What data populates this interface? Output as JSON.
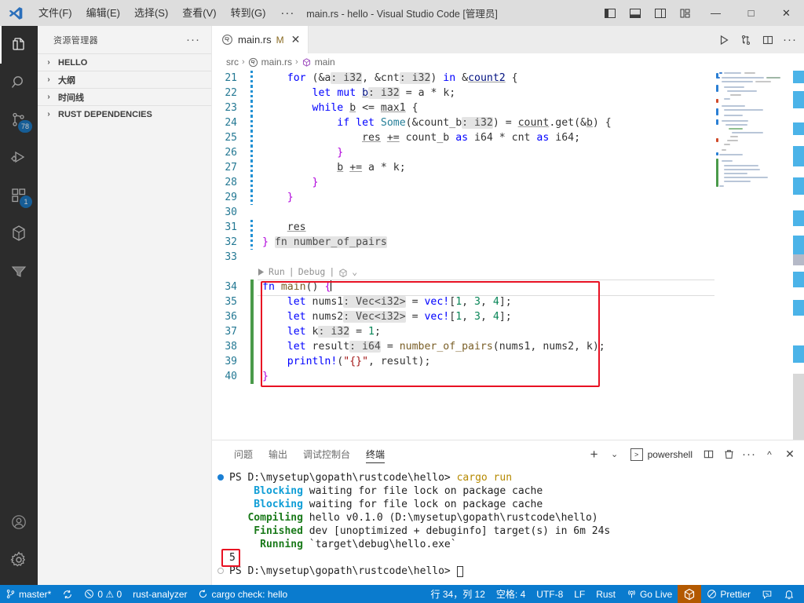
{
  "window": {
    "title": "main.rs - hello - Visual Studio Code [管理员]",
    "minimize": "—",
    "maximize": "□",
    "close": "✕"
  },
  "menu": {
    "items": [
      {
        "label": "文件(F)"
      },
      {
        "label": "编辑(E)"
      },
      {
        "label": "选择(S)"
      },
      {
        "label": "查看(V)"
      },
      {
        "label": "转到(G)"
      }
    ],
    "more": "···"
  },
  "activitybar": {
    "items": [
      {
        "name": "explorer",
        "badge": ""
      },
      {
        "name": "search",
        "badge": ""
      },
      {
        "name": "source-control",
        "badge": "78"
      },
      {
        "name": "run-and-debug",
        "badge": ""
      },
      {
        "name": "extensions",
        "badge": "1"
      },
      {
        "name": "crates",
        "badge": ""
      },
      {
        "name": "filter",
        "badge": ""
      }
    ],
    "accounts": "accounts",
    "settings": "settings"
  },
  "sidebar": {
    "title": "资源管理器",
    "more": "···",
    "sections": [
      {
        "label": "HELLO",
        "chevron": "›"
      },
      {
        "label": "大纲",
        "chevron": "›"
      },
      {
        "label": "时间线",
        "chevron": "›"
      },
      {
        "label": "RUST DEPENDENCIES",
        "chevron": "›"
      }
    ]
  },
  "editor": {
    "tab": {
      "filename": "main.rs",
      "dirty": "M",
      "close": "✕"
    },
    "breadcrumb": [
      "src",
      "main.rs",
      "main"
    ],
    "breadcrumb_sep": "›",
    "codelens": {
      "run": "Run",
      "sep1": "|",
      "debug": "Debug",
      "sep2": "|",
      "chevron": "⌄"
    },
    "cursor_line": 34,
    "lines": [
      {
        "n": 21,
        "git": "mod",
        "indent": 2
      },
      {
        "n": 22,
        "git": "mod",
        "indent": 3
      },
      {
        "n": 23,
        "git": "mod",
        "indent": 3
      },
      {
        "n": 24,
        "git": "mod",
        "indent": 4
      },
      {
        "n": 25,
        "git": "mod",
        "indent": 5
      },
      {
        "n": 26,
        "git": "mod",
        "indent": 4
      },
      {
        "n": 27,
        "git": "mod",
        "indent": 4
      },
      {
        "n": 28,
        "git": "mod",
        "indent": 3
      },
      {
        "n": 29,
        "git": "mod",
        "indent": 2
      },
      {
        "n": 30,
        "git": "mod",
        "indent": 0
      },
      {
        "n": 31,
        "git": "mod",
        "indent": 1
      },
      {
        "n": 32,
        "git": "mod",
        "indent": 0
      },
      {
        "n": 33,
        "git": "mod",
        "indent": 0
      },
      {
        "n": 34,
        "git": "add",
        "indent": 0
      },
      {
        "n": 35,
        "git": "add",
        "indent": 1
      },
      {
        "n": 36,
        "git": "add",
        "indent": 1
      },
      {
        "n": 37,
        "git": "add",
        "indent": 1
      },
      {
        "n": 38,
        "git": "add",
        "indent": 1
      },
      {
        "n": 39,
        "git": "add",
        "indent": 1
      },
      {
        "n": 40,
        "git": "add",
        "indent": 0
      }
    ],
    "source": [
      "    for (&a: i32, &cnt: i32) in &count2 {",
      "        let mut b: i32 = a * k;",
      "        while b <= max1 {",
      "            if let Some(&count_b: i32) = count.get(&b) {",
      "                res += count_b as i64 * cnt as i64;",
      "            }",
      "            b += a * k;",
      "        }",
      "    }",
      "",
      "    res",
      "} fn number_of_pairs",
      "",
      "fn main() {",
      "    let nums1: Vec<i32> = vec![1, 3, 4];",
      "    let nums2: Vec<i32> = vec![1, 3, 4];",
      "    let k: i32 = 1;",
      "    let result: i64 = number_of_pairs(nums1, nums2, k);",
      "    println!(\"{}\", result);",
      "}"
    ]
  },
  "panel": {
    "tabs": [
      {
        "label": "问题",
        "active": false
      },
      {
        "label": "输出",
        "active": false
      },
      {
        "label": "调试控制台",
        "active": false
      },
      {
        "label": "终端",
        "active": true
      }
    ],
    "terminal_name": "powershell",
    "actions": {
      "add": "+",
      "chevron": "⌄",
      "split": "split",
      "kill": "trash",
      "more": "···",
      "maximize": "^",
      "close": "✕"
    },
    "terminal_lines": [
      {
        "deco": "full",
        "segments": [
          {
            "t": "PS D:\\mysetup\\gopath\\rustcode\\hello>",
            "c": "plain"
          },
          {
            "t": " cargo run",
            "c": "yellow"
          }
        ]
      },
      {
        "deco": "",
        "segments": [
          {
            "t": "    Blocking",
            "c": "cyan"
          },
          {
            "t": " waiting for file lock on package cache",
            "c": "plain"
          }
        ]
      },
      {
        "deco": "",
        "segments": [
          {
            "t": "    Blocking",
            "c": "cyan"
          },
          {
            "t": " waiting for file lock on package cache",
            "c": "plain"
          }
        ]
      },
      {
        "deco": "",
        "segments": [
          {
            "t": "   Compiling",
            "c": "green"
          },
          {
            "t": " hello v0.1.0 (D:\\mysetup\\gopath\\rustcode\\hello)",
            "c": "plain"
          }
        ]
      },
      {
        "deco": "",
        "segments": [
          {
            "t": "    Finished",
            "c": "green"
          },
          {
            "t": " dev [unoptimized + debuginfo] target(s) in 6m 24s",
            "c": "plain"
          }
        ]
      },
      {
        "deco": "",
        "segments": [
          {
            "t": "     Running",
            "c": "green"
          },
          {
            "t": " `target\\debug\\hello.exe`",
            "c": "plain"
          }
        ]
      },
      {
        "deco": "",
        "segments": [
          {
            "t": "5",
            "c": "plain"
          }
        ],
        "highlight": true
      },
      {
        "deco": "hollow",
        "segments": [
          {
            "t": "PS D:\\mysetup\\gopath\\rustcode\\hello> ",
            "c": "plain"
          }
        ],
        "cursor": true
      }
    ]
  },
  "statusbar": {
    "left": [
      {
        "name": "branch",
        "icon": "branch",
        "label": "master*"
      },
      {
        "name": "sync",
        "icon": "sync",
        "label": ""
      },
      {
        "name": "problems",
        "icon": "errors",
        "label": "0 ⚠ 0"
      },
      {
        "name": "rust-analyzer",
        "icon": "",
        "label": "rust-analyzer"
      },
      {
        "name": "cargo-check",
        "icon": "loading",
        "label": "cargo check: hello"
      }
    ],
    "right": [
      {
        "name": "cursor-position",
        "label": "行 34，列 12"
      },
      {
        "name": "indentation",
        "label": "空格: 4"
      },
      {
        "name": "encoding",
        "label": "UTF-8"
      },
      {
        "name": "eol",
        "label": "LF"
      },
      {
        "name": "language-mode",
        "label": "Rust"
      },
      {
        "name": "go-live",
        "label": "Go Live"
      },
      {
        "name": "rust-icon",
        "label": ""
      },
      {
        "name": "prettier",
        "label": "Prettier"
      },
      {
        "name": "feedback",
        "label": ""
      },
      {
        "name": "notifications",
        "label": ""
      }
    ],
    "accent": "#0a7bce",
    "rust_bg": "#b35900"
  }
}
